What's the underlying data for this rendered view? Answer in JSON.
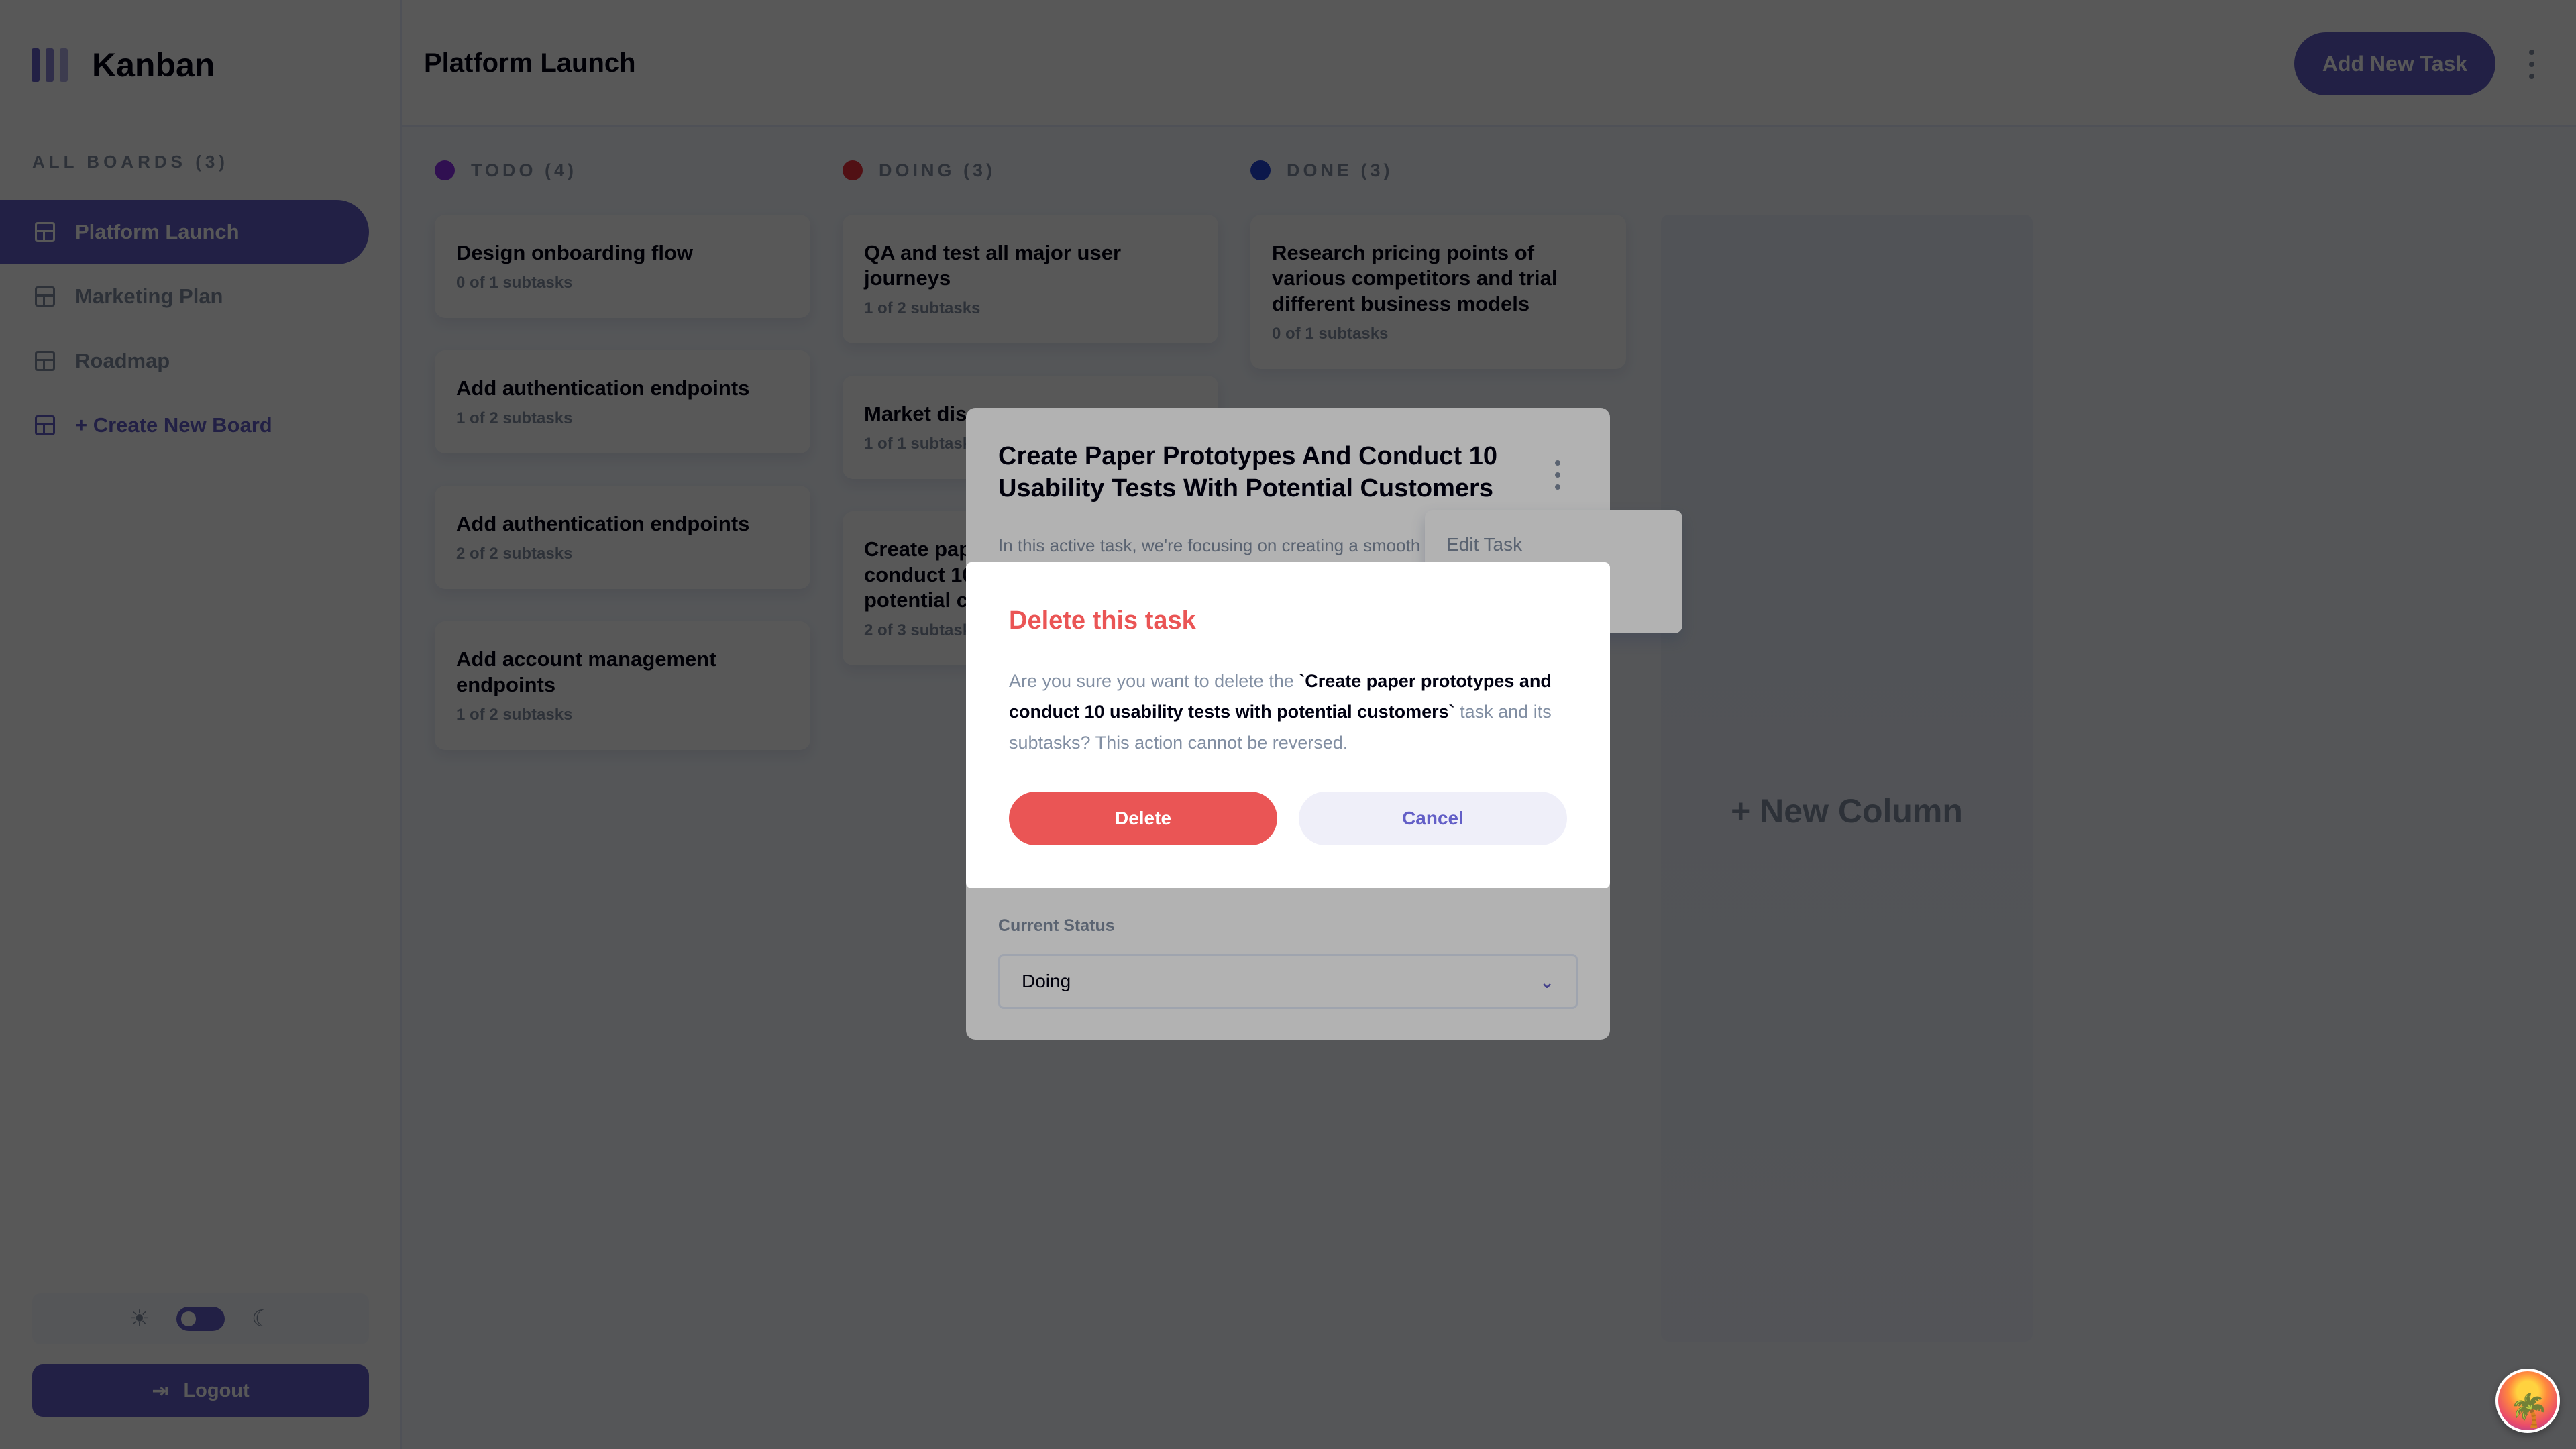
{
  "app": {
    "name": "Kanban"
  },
  "sidebar": {
    "boards_title": "ALL BOARDS (3)",
    "items": [
      {
        "label": "Platform Launch",
        "active": true
      },
      {
        "label": "Marketing Plan",
        "active": false
      },
      {
        "label": "Roadmap",
        "active": false
      },
      {
        "label": "+ Create New Board",
        "active": false
      }
    ],
    "logout_label": "Logout"
  },
  "header": {
    "title": "Platform Launch",
    "add_task_label": "Add New Task"
  },
  "columns": [
    {
      "title": "TODO (4)",
      "dot_color": "#8d31e8",
      "cards": [
        {
          "title": "Design onboarding flow",
          "subtasks": "0 of 1 subtasks"
        },
        {
          "title": "Add authentication endpoints",
          "subtasks": "1 of 2 subtasks"
        },
        {
          "title": "Add authentication endpoints",
          "subtasks": "2 of 2 subtasks"
        },
        {
          "title": "Add account management endpoints",
          "subtasks": "1 of 2 subtasks"
        }
      ]
    },
    {
      "title": "DOING (3)",
      "dot_color": "#e8313a",
      "cards": [
        {
          "title": "QA and test all major user journeys",
          "subtasks": "1 of 2 subtasks"
        },
        {
          "title": "Market discovery",
          "subtasks": "1 of 1 subtasks"
        },
        {
          "title": "Create paper prototypes and conduct 10 usability tests with potential customers",
          "subtasks": "2 of 3 subtasks"
        }
      ]
    },
    {
      "title": "DONE (3)",
      "dot_color": "#2446d9",
      "cards": [
        {
          "title": "Research pricing points of various competitors and trial different business models",
          "subtasks": "0 of 1 subtasks"
        }
      ]
    }
  ],
  "new_column_label": "+ New Column",
  "task_modal": {
    "title": "Create Paper Prototypes And Conduct 10 Usability Tests With Potential Customers",
    "description": "In this active task, we're focusing on creating a smooth",
    "status_label": "Current Status",
    "status_value": "Doing",
    "menu_edit": "Edit Task"
  },
  "delete_modal": {
    "title": "Delete this task",
    "text_before": "Are you sure you want to delete the ",
    "task_name": "`Create paper prototypes and conduct 10 usability tests with potential customers`",
    "text_after": " task and its subtasks? This action cannot be reversed.",
    "delete_label": "Delete",
    "cancel_label": "Cancel"
  },
  "colors": {
    "accent": "#635fc7",
    "danger": "#ea5555"
  },
  "icons": {
    "logo": "kanban-logo-icon",
    "board": "board-grid-icon",
    "sun": "sun-icon",
    "moon": "moon-icon",
    "logout": "logout-icon",
    "kebab": "vertical-ellipsis-icon",
    "chevron": "chevron-down-icon"
  }
}
